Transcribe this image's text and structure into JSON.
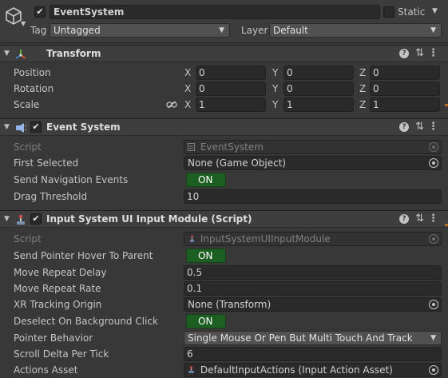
{
  "header": {
    "name": "EventSystem",
    "static_label": "Static",
    "tag_label": "Tag",
    "tag_value": "Untagged",
    "layer_label": "Layer",
    "layer_value": "Default",
    "active": true,
    "is_static": false
  },
  "transform": {
    "title": "Transform",
    "position": {
      "label": "Position",
      "x": "0",
      "y": "0",
      "z": "0"
    },
    "rotation": {
      "label": "Rotation",
      "x": "0",
      "y": "0",
      "z": "0"
    },
    "scale": {
      "label": "Scale",
      "x": "1",
      "y": "1",
      "z": "1"
    },
    "axis": {
      "x": "X",
      "y": "Y",
      "z": "Z"
    }
  },
  "event_system": {
    "title": "Event System",
    "script_label": "Script",
    "script_value": "EventSystem",
    "first_selected_label": "First Selected",
    "first_selected_value": "None (Game Object)",
    "send_nav_label": "Send Navigation Events",
    "send_nav_value": "ON",
    "drag_threshold_label": "Drag Threshold",
    "drag_threshold_value": "10"
  },
  "input_module": {
    "title": "Input System UI Input Module (Script)",
    "script_label": "Script",
    "script_value": "InputSystemUIInputModule",
    "hover_parent_label": "Send Pointer Hover To Parent",
    "hover_parent_value": "ON",
    "repeat_delay_label": "Move Repeat Delay",
    "repeat_delay_value": "0.5",
    "repeat_rate_label": "Move Repeat Rate",
    "repeat_rate_value": "0.1",
    "xr_origin_label": "XR Tracking Origin",
    "xr_origin_value": "None (Transform)",
    "deselect_label": "Deselect On Background Click",
    "deselect_value": "ON",
    "pointer_behavior_label": "Pointer Behavior",
    "pointer_behavior_value": "Single Mouse Or Pen But Multi Touch And Track",
    "scroll_delta_label": "Scroll Delta Per Tick",
    "scroll_delta_value": "6",
    "actions_asset_label": "Actions Asset",
    "actions_asset_value": "DefaultInputActions (Input Action Asset)"
  },
  "colors": {
    "panel_bg": "#383838",
    "header_bg": "#3e3e3e",
    "field_bg": "#2a2a2a",
    "toggle_on": "#1d5f23",
    "accent_orange": "#b06d22"
  }
}
